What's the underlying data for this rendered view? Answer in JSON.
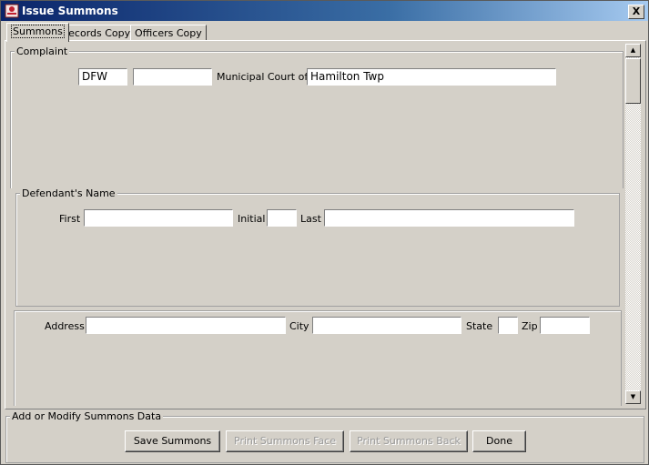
{
  "window": {
    "title": "Issue Summons",
    "close_label": "X"
  },
  "tabs": [
    "Summons",
    "Records Copy",
    "Officers Copy"
  ],
  "complaint": {
    "title": "Complaint",
    "prefix_value": "DFW",
    "number_value": "",
    "court_label": "Municipal Court of:",
    "court_value": "Hamilton Twp"
  },
  "defendant": {
    "title": "Defendant's Name",
    "first_label": "First",
    "first_value": "",
    "initial_label": "Initial",
    "initial_value": "",
    "last_label": "Last",
    "last_value": ""
  },
  "address": {
    "address_label": "Address",
    "address_value": "",
    "city_label": "City",
    "city_value": "",
    "state_label": "State",
    "state_value": "",
    "zip_label": "Zip",
    "zip_value": ""
  },
  "actions": {
    "title": "Add or Modify Summons Data",
    "save": "Save Summons",
    "print_face": "Print Summons Face",
    "print_back": "Print Summons Back",
    "done": "Done"
  }
}
